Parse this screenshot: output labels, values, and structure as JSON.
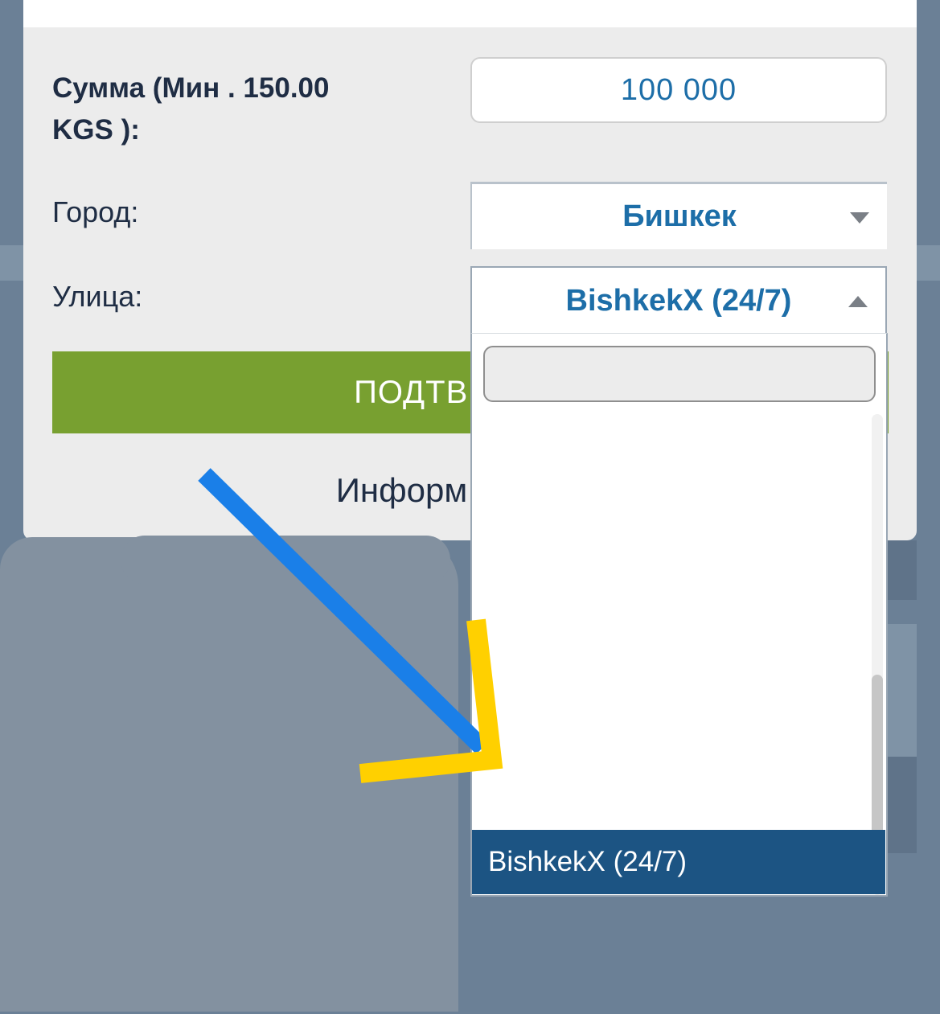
{
  "form": {
    "amount_label": "Сумма (Мин . 150.00 KGS ):",
    "amount_value": "100 000",
    "city_label": "Город:",
    "city_value": "Бишкек",
    "street_label": "Улица:",
    "street_value": "BishkekX (24/7)",
    "confirm_label": "ПОДТВЕ",
    "info_label": "Информ"
  },
  "dropdown": {
    "search_value": "",
    "selected_option": "BishkekX (24/7)"
  },
  "colors": {
    "accent_green": "#78a030",
    "selected_blue": "#1c5483",
    "text_blue": "#1d6ea8",
    "arrow_blue": "#1a7fe8",
    "arrow_yellow": "#ffd000"
  },
  "icons": {
    "city_caret": "chevron-down-icon",
    "street_caret": "chevron-up-icon"
  }
}
